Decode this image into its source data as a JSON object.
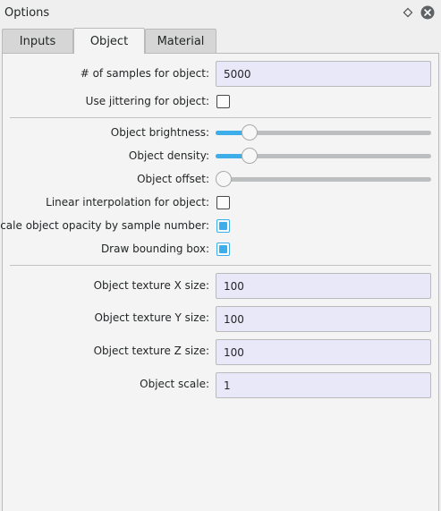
{
  "window": {
    "title": "Options"
  },
  "tabs": [
    {
      "label": "Inputs",
      "active": false
    },
    {
      "label": "Object",
      "active": true
    },
    {
      "label": "Material",
      "active": false
    }
  ],
  "form": {
    "samples": {
      "label": "# of samples for object:",
      "value": "5000"
    },
    "jittering": {
      "label": "Use jittering for object:",
      "checked": false
    },
    "brightness": {
      "label": "Object brightness:",
      "level": 0.13
    },
    "density": {
      "label": "Object density:",
      "level": 0.13
    },
    "offset": {
      "label": "Object offset:",
      "level": 0.0
    },
    "linear_interp": {
      "label": "Linear interpolation for object:",
      "checked": false
    },
    "scale_opacity": {
      "label": "Scale object opacity by sample number:",
      "checked": true
    },
    "bounding_box": {
      "label": "Draw bounding box:",
      "checked": true
    },
    "tex_x": {
      "label": "Object texture X size:",
      "value": "100"
    },
    "tex_y": {
      "label": "Object texture Y size:",
      "value": "100"
    },
    "tex_z": {
      "label": "Object texture Z size:",
      "value": "100"
    },
    "scale": {
      "label": "Object scale:",
      "value": "1"
    }
  },
  "colors": {
    "accent": "#3daee9",
    "field_bg": "#e8e8f9",
    "window_bg": "#efefef"
  },
  "icons": {
    "float": "diamond-icon",
    "close": "close-icon"
  }
}
